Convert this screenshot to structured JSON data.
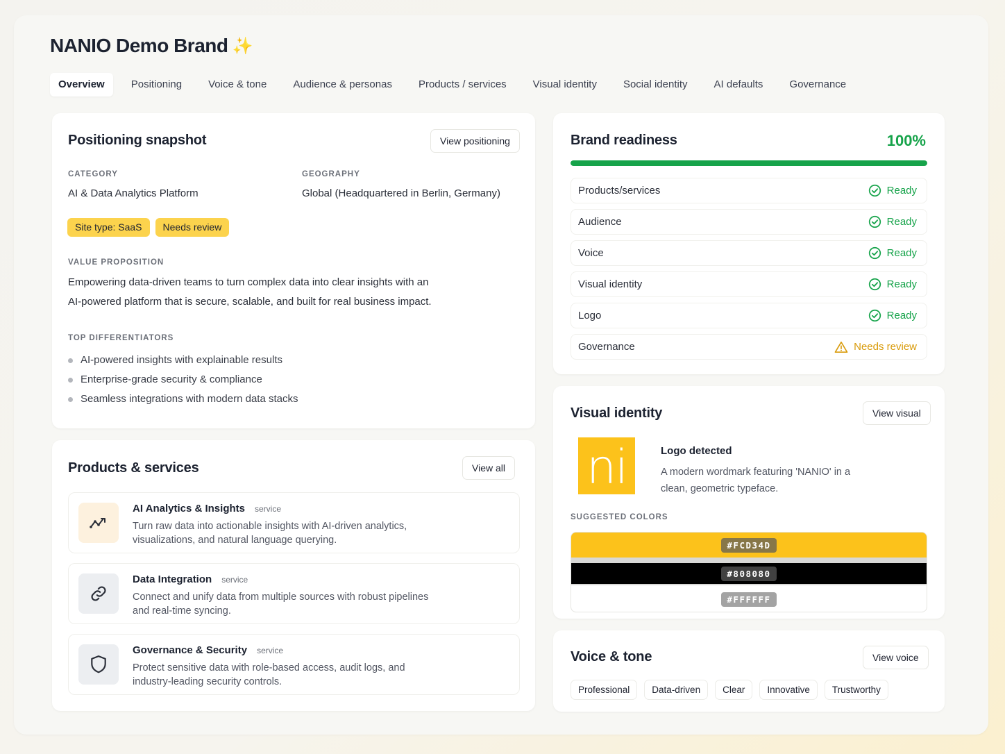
{
  "brand": {
    "title": "NANIO Demo Brand",
    "sparkle": "✨"
  },
  "tabs": [
    {
      "label": "Overview",
      "active": true
    },
    {
      "label": "Positioning"
    },
    {
      "label": "Voice & tone"
    },
    {
      "label": "Audience & personas"
    },
    {
      "label": "Products / services"
    },
    {
      "label": "Visual identity"
    },
    {
      "label": "Social identity"
    },
    {
      "label": "AI defaults"
    },
    {
      "label": "Governance"
    }
  ],
  "positioning": {
    "title": "Positioning snapshot",
    "button": "View positioning",
    "category_label": "CATEGORY",
    "category": "AI & Data Analytics Platform",
    "geography_label": "GEOGRAPHY",
    "geography": "Global (Headquartered in Berlin, Germany)",
    "tags": [
      "Site type: SaaS",
      "Needs review"
    ],
    "value_prop_label": "VALUE PROPOSITION",
    "value_prop_line1": "Empowering data-driven teams to turn complex data into clear insights with an",
    "value_prop_line2": "AI-powered platform that is secure, scalable, and built for real business impact.",
    "differentiators_label": "TOP DIFFERENTIATORS",
    "differentiators": [
      "AI-powered insights with explainable results",
      "Enterprise-grade security & compliance",
      "Seamless integrations with modern data stacks"
    ]
  },
  "products": {
    "title": "Products & services",
    "button": "View all",
    "items": [
      {
        "name": "AI Analytics & Insights",
        "kind": "service",
        "icon": "analytics-icon",
        "desc_line1": "Turn raw data into actionable insights with AI-driven analytics,",
        "desc_line2": "visualizations, and natural language querying."
      },
      {
        "name": "Data Integration",
        "kind": "service",
        "icon": "link-icon",
        "desc_line1": "Connect and unify data from multiple sources with robust pipelines",
        "desc_line2": "and real-time syncing."
      },
      {
        "name": "Governance & Security",
        "kind": "service",
        "icon": "shield-icon",
        "desc_line1": "Protect sensitive data with role-based access, audit logs, and",
        "desc_line2": "industry-leading security controls."
      }
    ]
  },
  "readiness": {
    "title": "Brand readiness",
    "percent_text": "100%",
    "progress_fraction": 1.0,
    "accent": "#16a34a",
    "warning": "#d99b0a",
    "rows": [
      {
        "label": "Products/services",
        "status": "Ready",
        "state": "ready"
      },
      {
        "label": "Audience",
        "status": "Ready",
        "state": "ready"
      },
      {
        "label": "Voice",
        "status": "Ready",
        "state": "ready"
      },
      {
        "label": "Visual identity",
        "status": "Ready",
        "state": "ready"
      },
      {
        "label": "Logo",
        "status": "Ready",
        "state": "ready"
      },
      {
        "label": "Governance",
        "status": "Needs review",
        "state": "review"
      }
    ]
  },
  "visual": {
    "title": "Visual identity",
    "button": "View visual",
    "logo_text": "ni",
    "logo_heading": "Logo detected",
    "logo_desc_line1": "A modern wordmark featuring 'NANIO' in a",
    "logo_desc_line2": "clean, geometric typeface.",
    "colors_label": "SUGGESTED COLORS",
    "colors": [
      {
        "hex": "#FCD34D",
        "swatch": "#fcc21b"
      },
      {
        "hex": "#808080",
        "swatch": "#000000"
      },
      {
        "hex": "#FFFFFF",
        "swatch": "#ffffff"
      }
    ]
  },
  "voice": {
    "title": "Voice & tone",
    "button": "View voice",
    "tags": [
      "Professional",
      "Data-driven",
      "Clear",
      "Innovative",
      "Trustworthy"
    ]
  }
}
